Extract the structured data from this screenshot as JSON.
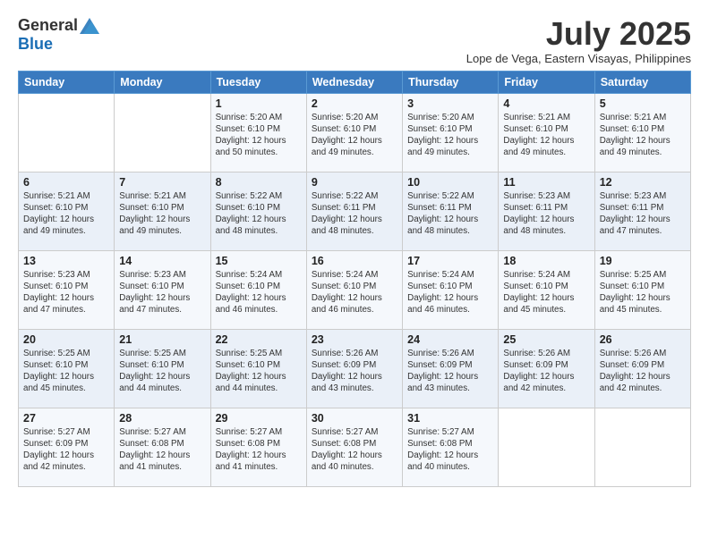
{
  "logo": {
    "general": "General",
    "blue": "Blue"
  },
  "title": "July 2025",
  "location": "Lope de Vega, Eastern Visayas, Philippines",
  "headers": [
    "Sunday",
    "Monday",
    "Tuesday",
    "Wednesday",
    "Thursday",
    "Friday",
    "Saturday"
  ],
  "weeks": [
    [
      {
        "day": "",
        "info": ""
      },
      {
        "day": "",
        "info": ""
      },
      {
        "day": "1",
        "info": "Sunrise: 5:20 AM\nSunset: 6:10 PM\nDaylight: 12 hours and 50 minutes."
      },
      {
        "day": "2",
        "info": "Sunrise: 5:20 AM\nSunset: 6:10 PM\nDaylight: 12 hours and 49 minutes."
      },
      {
        "day": "3",
        "info": "Sunrise: 5:20 AM\nSunset: 6:10 PM\nDaylight: 12 hours and 49 minutes."
      },
      {
        "day": "4",
        "info": "Sunrise: 5:21 AM\nSunset: 6:10 PM\nDaylight: 12 hours and 49 minutes."
      },
      {
        "day": "5",
        "info": "Sunrise: 5:21 AM\nSunset: 6:10 PM\nDaylight: 12 hours and 49 minutes."
      }
    ],
    [
      {
        "day": "6",
        "info": "Sunrise: 5:21 AM\nSunset: 6:10 PM\nDaylight: 12 hours and 49 minutes."
      },
      {
        "day": "7",
        "info": "Sunrise: 5:21 AM\nSunset: 6:10 PM\nDaylight: 12 hours and 49 minutes."
      },
      {
        "day": "8",
        "info": "Sunrise: 5:22 AM\nSunset: 6:10 PM\nDaylight: 12 hours and 48 minutes."
      },
      {
        "day": "9",
        "info": "Sunrise: 5:22 AM\nSunset: 6:11 PM\nDaylight: 12 hours and 48 minutes."
      },
      {
        "day": "10",
        "info": "Sunrise: 5:22 AM\nSunset: 6:11 PM\nDaylight: 12 hours and 48 minutes."
      },
      {
        "day": "11",
        "info": "Sunrise: 5:23 AM\nSunset: 6:11 PM\nDaylight: 12 hours and 48 minutes."
      },
      {
        "day": "12",
        "info": "Sunrise: 5:23 AM\nSunset: 6:11 PM\nDaylight: 12 hours and 47 minutes."
      }
    ],
    [
      {
        "day": "13",
        "info": "Sunrise: 5:23 AM\nSunset: 6:10 PM\nDaylight: 12 hours and 47 minutes."
      },
      {
        "day": "14",
        "info": "Sunrise: 5:23 AM\nSunset: 6:10 PM\nDaylight: 12 hours and 47 minutes."
      },
      {
        "day": "15",
        "info": "Sunrise: 5:24 AM\nSunset: 6:10 PM\nDaylight: 12 hours and 46 minutes."
      },
      {
        "day": "16",
        "info": "Sunrise: 5:24 AM\nSunset: 6:10 PM\nDaylight: 12 hours and 46 minutes."
      },
      {
        "day": "17",
        "info": "Sunrise: 5:24 AM\nSunset: 6:10 PM\nDaylight: 12 hours and 46 minutes."
      },
      {
        "day": "18",
        "info": "Sunrise: 5:24 AM\nSunset: 6:10 PM\nDaylight: 12 hours and 45 minutes."
      },
      {
        "day": "19",
        "info": "Sunrise: 5:25 AM\nSunset: 6:10 PM\nDaylight: 12 hours and 45 minutes."
      }
    ],
    [
      {
        "day": "20",
        "info": "Sunrise: 5:25 AM\nSunset: 6:10 PM\nDaylight: 12 hours and 45 minutes."
      },
      {
        "day": "21",
        "info": "Sunrise: 5:25 AM\nSunset: 6:10 PM\nDaylight: 12 hours and 44 minutes."
      },
      {
        "day": "22",
        "info": "Sunrise: 5:25 AM\nSunset: 6:10 PM\nDaylight: 12 hours and 44 minutes."
      },
      {
        "day": "23",
        "info": "Sunrise: 5:26 AM\nSunset: 6:09 PM\nDaylight: 12 hours and 43 minutes."
      },
      {
        "day": "24",
        "info": "Sunrise: 5:26 AM\nSunset: 6:09 PM\nDaylight: 12 hours and 43 minutes."
      },
      {
        "day": "25",
        "info": "Sunrise: 5:26 AM\nSunset: 6:09 PM\nDaylight: 12 hours and 42 minutes."
      },
      {
        "day": "26",
        "info": "Sunrise: 5:26 AM\nSunset: 6:09 PM\nDaylight: 12 hours and 42 minutes."
      }
    ],
    [
      {
        "day": "27",
        "info": "Sunrise: 5:27 AM\nSunset: 6:09 PM\nDaylight: 12 hours and 42 minutes."
      },
      {
        "day": "28",
        "info": "Sunrise: 5:27 AM\nSunset: 6:08 PM\nDaylight: 12 hours and 41 minutes."
      },
      {
        "day": "29",
        "info": "Sunrise: 5:27 AM\nSunset: 6:08 PM\nDaylight: 12 hours and 41 minutes."
      },
      {
        "day": "30",
        "info": "Sunrise: 5:27 AM\nSunset: 6:08 PM\nDaylight: 12 hours and 40 minutes."
      },
      {
        "day": "31",
        "info": "Sunrise: 5:27 AM\nSunset: 6:08 PM\nDaylight: 12 hours and 40 minutes."
      },
      {
        "day": "",
        "info": ""
      },
      {
        "day": "",
        "info": ""
      }
    ]
  ]
}
